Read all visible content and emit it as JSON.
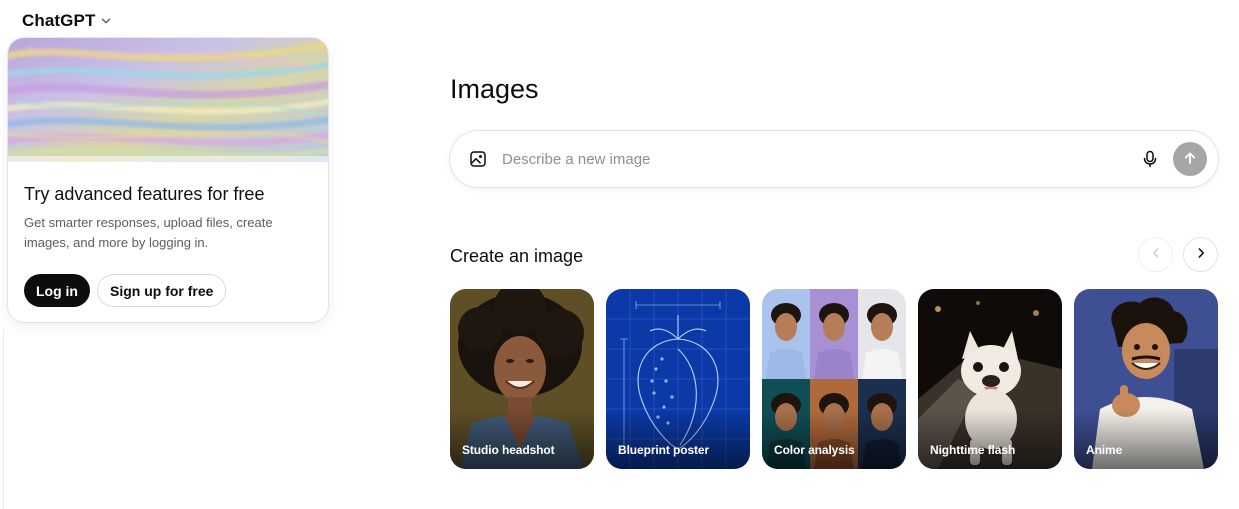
{
  "header": {
    "model_name": "ChatGPT",
    "model_icon": "chevron-down-icon"
  },
  "promo": {
    "title": "Try advanced features for free",
    "description": "Get smarter responses, upload files, create images, and more by logging in.",
    "login_label": "Log in",
    "signup_label": "Sign up for free"
  },
  "main": {
    "title": "Images",
    "composer": {
      "placeholder": "Describe a new image",
      "leading_icon": "image-icon",
      "mic_icon": "microphone-icon",
      "send_icon": "arrow-up-icon"
    },
    "section_title": "Create an image",
    "carousel": {
      "prev_icon": "chevron-left-icon",
      "next_icon": "chevron-right-icon"
    },
    "styles": [
      {
        "label": "Studio headshot"
      },
      {
        "label": "Blueprint poster"
      },
      {
        "label": "Color analysis"
      },
      {
        "label": "Nighttime flash"
      },
      {
        "label": "Anime"
      }
    ]
  },
  "colors": {
    "primary_button": "#0d0d0d",
    "send_button_disabled": "#a6a6a6",
    "muted_text": "#5d5d5d",
    "placeholder_text": "#8f8f8f"
  }
}
